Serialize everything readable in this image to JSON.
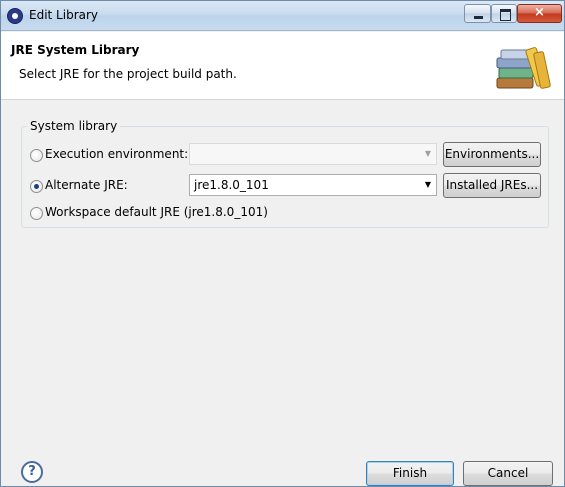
{
  "window": {
    "title": "Edit Library",
    "close_glyph": "×"
  },
  "banner": {
    "heading": "JRE System Library",
    "subtitle": "Select JRE for the project build path.",
    "icon": "library-books-icon"
  },
  "group": {
    "label": "System library",
    "options": [
      {
        "label": "Execution environment:",
        "selected": false,
        "combo_value": "",
        "combo_enabled": false,
        "button": "Environments..."
      },
      {
        "label": "Alternate JRE:",
        "selected": true,
        "combo_value": "jre1.8.0_101",
        "combo_enabled": true,
        "button": "Installed JREs..."
      },
      {
        "label": "Workspace default JRE (jre1.8.0_101)",
        "selected": false
      }
    ]
  },
  "footer": {
    "help_glyph": "?",
    "finish_label": "Finish",
    "cancel_label": "Cancel"
  },
  "dropdown_glyph": "▼"
}
